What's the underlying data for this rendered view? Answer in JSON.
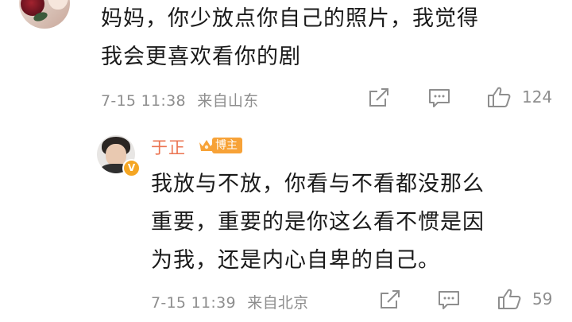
{
  "comment": {
    "text_line1": "妈妈，你少放点你自己的照片，我觉得",
    "text_line2": "我会更喜欢看你的剧",
    "time": "7-15 11:38",
    "location": "来自山东",
    "likes": "124",
    "icons": [
      "share-icon",
      "comment-icon",
      "like-icon"
    ]
  },
  "reply": {
    "username": "于正",
    "badge_label": "博主",
    "verified_mark": "V",
    "text_line1": "我放与不放，你看与不看都没那么",
    "text_line2": "重要，重要的是你这么看不惯是因",
    "text_line3": "为我，还是内心自卑的自己。",
    "time": "7-15 11:39",
    "location": "来自北京",
    "likes": "59",
    "icons": [
      "share-icon",
      "comment-icon",
      "like-icon"
    ]
  },
  "colors": {
    "username": "#eb7350",
    "meta_gray": "#8e8e8e",
    "badge_orange": "#f7a237",
    "verified_orange": "#f5a623"
  }
}
